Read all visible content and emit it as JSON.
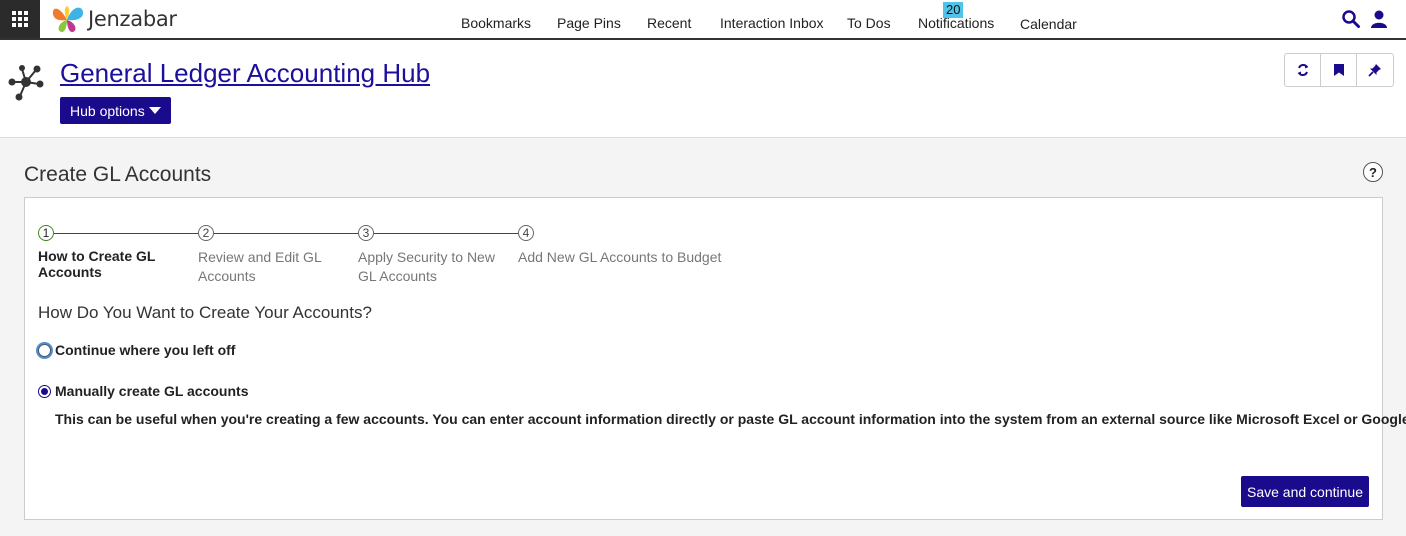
{
  "app": {
    "logo_text": "Jenzabar"
  },
  "nav": {
    "items": [
      {
        "label": "Bookmarks"
      },
      {
        "label": "Page Pins"
      },
      {
        "label": "Recent"
      },
      {
        "label": "Interaction Inbox"
      },
      {
        "label": "To Dos"
      },
      {
        "label": "Notifications"
      },
      {
        "label": "Calendar"
      }
    ],
    "notifications_count": "20"
  },
  "hub": {
    "title": "General Ledger Accounting Hub",
    "options_label": "Hub options"
  },
  "page": {
    "title": "Create GL Accounts",
    "help_label": "?"
  },
  "wizard": {
    "steps": [
      {
        "number": "1",
        "label": "How to Create GL Accounts"
      },
      {
        "number": "2",
        "label": "Review and Edit GL Accounts"
      },
      {
        "number": "3",
        "label": "Apply Security to New GL Accounts"
      },
      {
        "number": "4",
        "label": "Add New GL Accounts to Budget"
      }
    ],
    "question": "How Do You Want to Create Your Accounts?",
    "options": [
      {
        "label": "Continue where you left off"
      },
      {
        "label": "Manually create GL accounts"
      }
    ],
    "selected_option": "Manually create GL accounts",
    "manual_description": "This can be useful when you're creating a few accounts. You can enter account information directly or paste GL account information into the system from an external source like Microsoft Excel or Google Sheets.",
    "save_label": "Save and continue"
  },
  "colors": {
    "primary": "#1a0a8c",
    "badge": "#4fc3e8",
    "active_step": "#3a8a1e"
  }
}
